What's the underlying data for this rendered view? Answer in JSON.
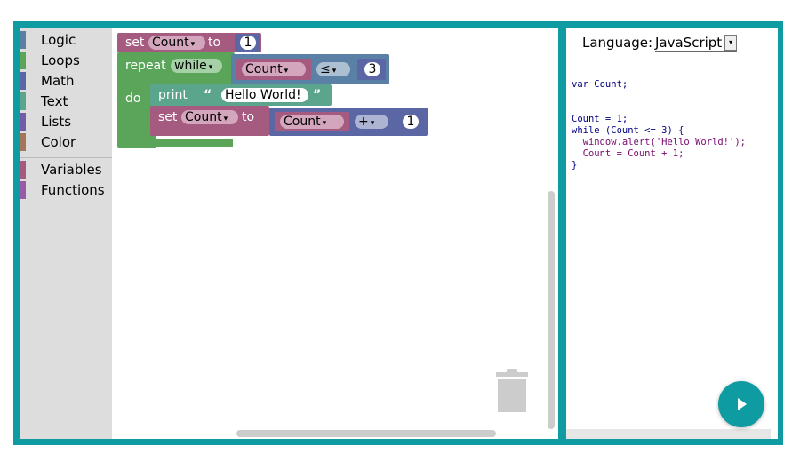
{
  "toolbox": {
    "categories": [
      {
        "label": "Logic",
        "color": "#5b80a5"
      },
      {
        "label": "Loops",
        "color": "#5ba55b"
      },
      {
        "label": "Math",
        "color": "#5b67a5"
      },
      {
        "label": "Text",
        "color": "#5ba58c"
      },
      {
        "label": "Lists",
        "color": "#745ba5"
      },
      {
        "label": "Color",
        "color": "#a5745b"
      },
      {
        "label": "Variables",
        "color": "#a55b80"
      },
      {
        "label": "Functions",
        "color": "#995ba5"
      }
    ]
  },
  "blocks": {
    "set1": {
      "keyword": "set",
      "variable": "Count",
      "to": "to",
      "value": "1"
    },
    "repeat": {
      "keyword": "repeat",
      "mode": "while",
      "do": "do"
    },
    "condition": {
      "variable": "Count",
      "operator": "≤",
      "value": "3"
    },
    "print": {
      "keyword": "print",
      "open_quote": "“",
      "text": "Hello World!",
      "close_quote": "”"
    },
    "set2": {
      "keyword": "set",
      "variable": "Count",
      "to": "to"
    },
    "arith": {
      "variable": "Count",
      "operator": "+",
      "value": "1"
    },
    "dropdown_glyph": "▾"
  },
  "colors": {
    "frame": "#0e9ba1",
    "variables": "#a55b80",
    "loops": "#5ba55b",
    "math": "#5b67a5",
    "text": "#5ba58c",
    "logic": "#5b80a5"
  },
  "code_pane": {
    "language_label": "Language:",
    "language_value": "JavaScript",
    "code_lines": [
      "var Count;",
      "",
      "",
      "Count = 1;",
      "while (Count <= 3) {",
      "  window.alert('Hello World!');",
      "  Count = Count + 1;",
      "}"
    ]
  },
  "icons": {
    "trash": "trash-icon",
    "run": "play-icon"
  }
}
